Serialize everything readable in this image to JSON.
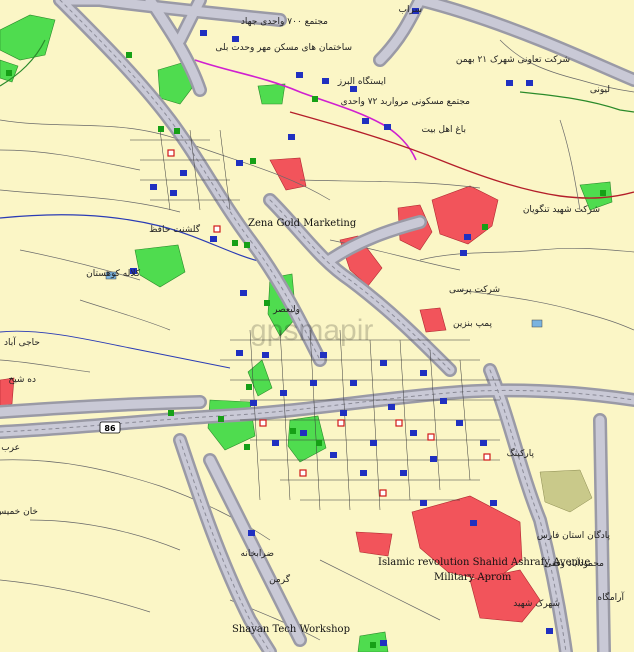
{
  "map": {
    "colors": {
      "background": "#fbf6c6",
      "road_casing": "#9a9aa6",
      "road_fill": "#c9c9d6",
      "park": "#4fdc4f",
      "restricted": "#f2545b",
      "river": "#2a3bb5",
      "rail": "#d020d0",
      "local_road": "#5a5a5a",
      "poi": "#2030c0"
    },
    "watermark": "gpsmapir",
    "road_shield": "86",
    "labels_en": [
      "Zena Gold Marketing",
      "Islamic revolution Shahid Ashrafy Avenue",
      "Military Aprom",
      "Shayan Tech Workshop"
    ],
    "labels_fa": [
      "مجتمع ۷۰۰ واحدی جهاد",
      "ساختمان های مسکن مهر وحدت بلی",
      "مجتمع مسکونی مرواربد ۷۲ واحدی",
      "ایستگاه البرز",
      "باغ اهل بیت",
      "شرکت تعاونی شهرک ۲۱ بهمن",
      "شرکت شهید تنگویان",
      "شرکت پرسی",
      "پمپ بنزین",
      "کلاله کوهستان",
      "گلشنت حافظ",
      "حاجی آباد",
      "ده شیخ",
      "خان خمیس",
      "پارکینگ",
      "پادگان استان فارس",
      "محمودآباد وقفی",
      "آرامگاه",
      "ولیعصر",
      "لیونی",
      "سراب",
      "شهرک شهید",
      "عرب",
      "ضرابخانه",
      "گرمن"
    ]
  }
}
